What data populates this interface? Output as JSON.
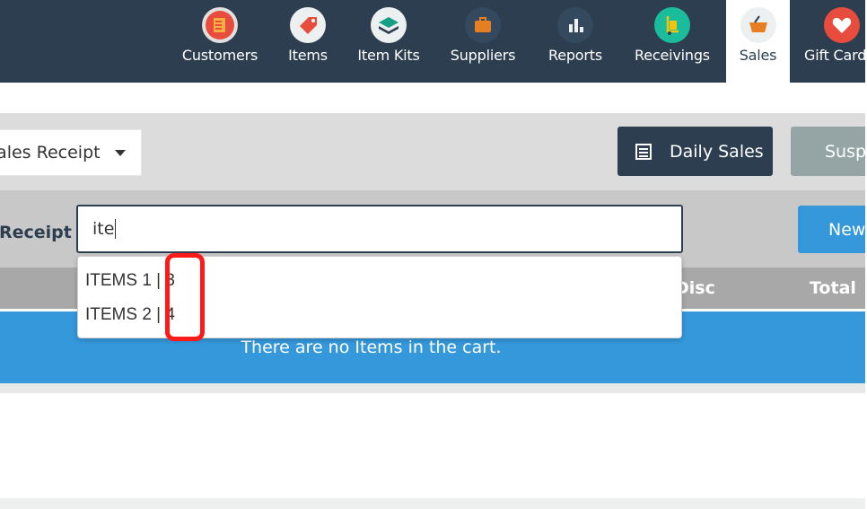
{
  "nav": {
    "items": [
      {
        "label": "Customers",
        "icon": "address-book-icon",
        "color": "#e74c3c"
      },
      {
        "label": "Items",
        "icon": "tag-icon",
        "color": "#e74c3c"
      },
      {
        "label": "Item Kits",
        "icon": "layers-icon",
        "color": "#16a085"
      },
      {
        "label": "Suppliers",
        "icon": "briefcase-icon",
        "color": "#e67e22"
      },
      {
        "label": "Reports",
        "icon": "bar-chart-icon",
        "color": "#34495e"
      },
      {
        "label": "Receivings",
        "icon": "hand-truck-icon",
        "color": "#1abc9c"
      },
      {
        "label": "Sales",
        "icon": "basket-icon",
        "color": "#e67e22"
      },
      {
        "label": "Gift Cards",
        "icon": "heart-icon",
        "color": "#e74c3c"
      }
    ],
    "active": "Sales"
  },
  "register": {
    "mode_selected": "Sales Receipt",
    "daily_sales_label": "Daily Sales",
    "suspended_label": "Suspended"
  },
  "entry": {
    "receipt_label": "Receipt",
    "input_value": "ite",
    "new_item_label": "New Item",
    "autocomplete": [
      "ITEMS 1 | 3",
      "ITEMS 2 | 4"
    ]
  },
  "table": {
    "columns": [
      "Disc",
      "Total"
    ],
    "empty_message": "There are no Items in the cart."
  },
  "colors": {
    "nav_bg": "#2c3e50",
    "primary_blue": "#3498db",
    "annotation_red": "#ff1a1a"
  }
}
